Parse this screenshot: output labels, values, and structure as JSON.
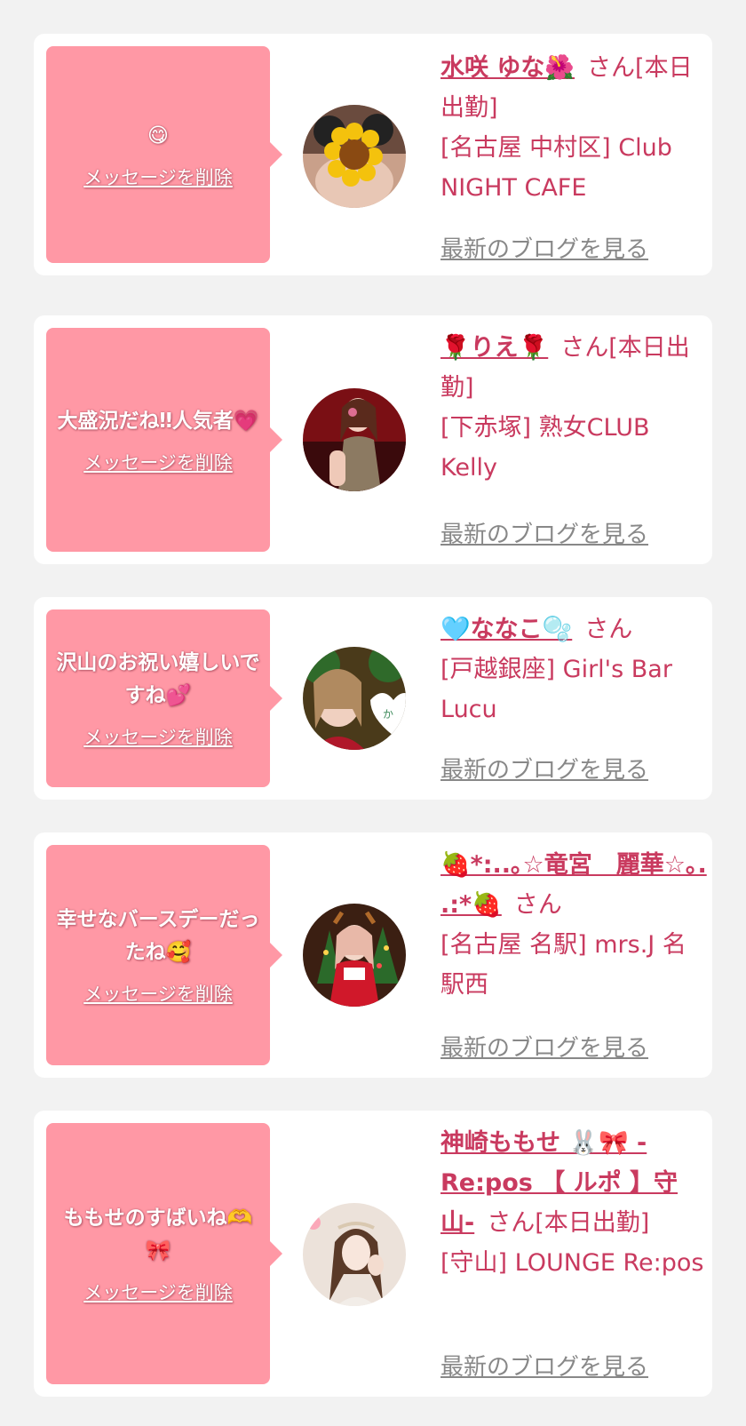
{
  "delete_label": "メッセージを削除",
  "blog_label": "最新のブログを見る",
  "items": [
    {
      "message": "😋 ",
      "name": "水咲 ゆな🌺",
      "suffix": "さん[本日出勤]",
      "shop": "[名古屋 中村区] Club NIGHT CAFE"
    },
    {
      "message": "大盛況だね‼人気者💗",
      "name": "🌹りえ🌹",
      "suffix": "さん[本日出勤]",
      "shop": "[下赤塚] 熟女CLUB Kelly"
    },
    {
      "message": "沢山のお祝い嬉しいですね💕",
      "name": "🩵ななこ🫧",
      "suffix": "さん",
      "shop": "[戸越銀座] Girl's Bar Lucu"
    },
    {
      "message": "幸せなバースデーだったね🥰",
      "name": "🍓*:..｡☆竜宮　麗華☆｡. .:*🍓",
      "suffix": "さん",
      "shop": "[名古屋 名駅] mrs.J 名駅西"
    },
    {
      "message": "ももせのすばいね🫶🎀",
      "name": "神崎ももせ 🐰🎀 -Re:pos 【 ルポ 】守山-",
      "suffix": "さん[本日出勤]",
      "shop": "[守山] LOUNGE Re:pos"
    }
  ]
}
